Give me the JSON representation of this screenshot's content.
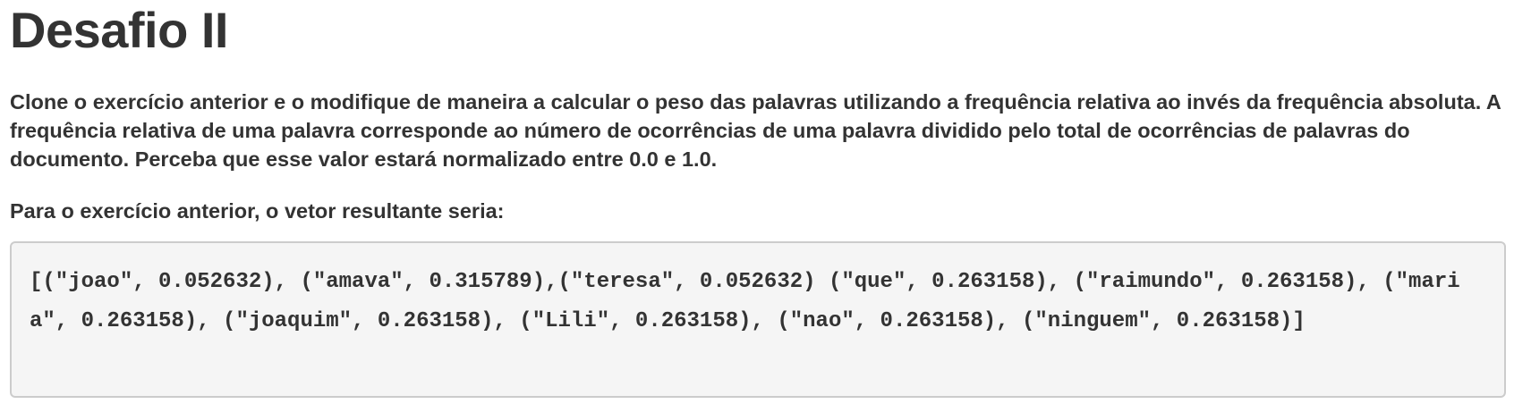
{
  "heading": "Desafio II",
  "paragraphs": {
    "intro": "Clone o exercício anterior e o modifique de maneira a calcular o peso das palavras utilizando a frequência relativa ao invés da frequência absoluta. A frequência relativa de uma palavra corresponde ao número de ocorrências de uma palavra dividido pelo total de ocorrências de palavras do documento. Perceba que esse valor estará normalizado entre 0.0 e 1.0.",
    "result_label": "Para o exercício anterior, o vetor resultante seria:"
  },
  "code": {
    "text": "[(\"joao\", 0.052632), (\"amava\", 0.315789),(\"teresa\", 0.052632) (\"que\", 0.263158), (\"raimundo\", 0.263158), (\"maria\", 0.263158), (\"joaquim\", 0.263158), (\"Lili\", 0.263158), (\"nao\", 0.263158), (\"ninguem\", 0.263158)]"
  }
}
